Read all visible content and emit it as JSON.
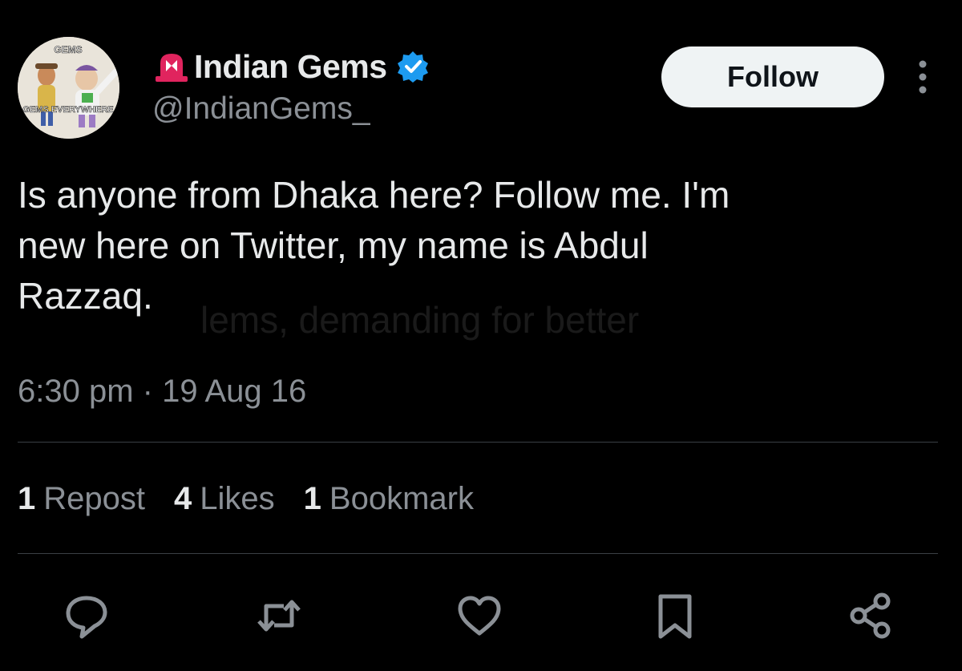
{
  "author": {
    "avatar_top_text": "GEMS",
    "avatar_bottom_text": "GEMS EVERYWHERE",
    "display_name": "Indian Gems",
    "handle": "@IndianGems_",
    "verified_icon": "verified-badge-icon",
    "name_emoji_icon": "siren-icon"
  },
  "follow_button": {
    "label": "Follow"
  },
  "tweet": {
    "lines": [
      "Is anyone from Dhaka here? Follow me. I'm",
      "new here on Twitter, my name is Abdul",
      "Razzaq."
    ],
    "ghost_text": "lems, demanding for better",
    "timestamp": "6:30 pm · 19 Aug 16"
  },
  "stats": [
    {
      "count": "1",
      "label": "Repost"
    },
    {
      "count": "4",
      "label": "Likes"
    },
    {
      "count": "1",
      "label": "Bookmark"
    }
  ],
  "actions": [
    "reply-icon",
    "repost-icon",
    "like-icon",
    "bookmark-icon",
    "share-icon"
  ],
  "colors": {
    "background": "#000000",
    "text": "#e7e9ea",
    "secondary_text": "#8b9096",
    "verified_blue": "#1d9bf0",
    "siren_red": "#e0245e",
    "follow_bg": "#eff3f4"
  }
}
